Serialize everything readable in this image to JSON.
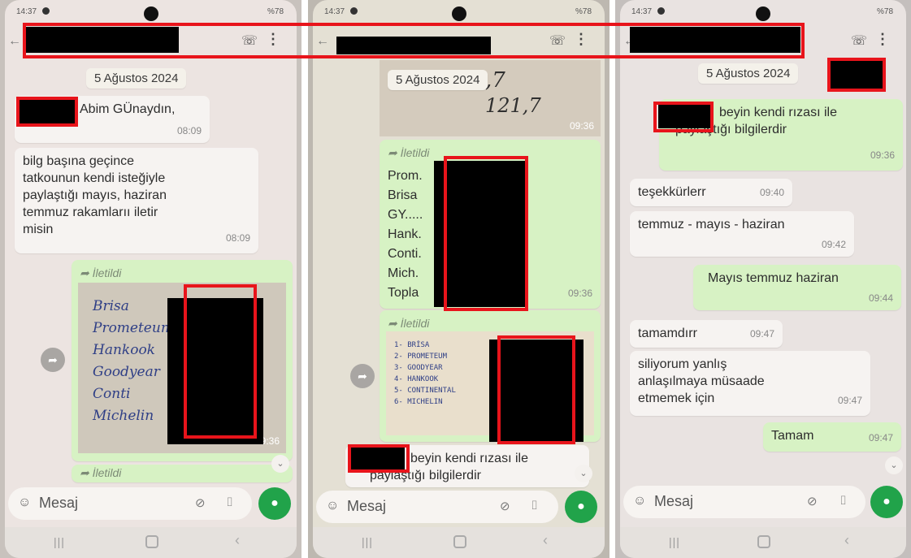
{
  "status": {
    "time": "14:37",
    "battery": "%78"
  },
  "labels": {
    "date": "5 Ağustos 2024",
    "forwarded": "İletildi",
    "input_placeholder": "Mesaj"
  },
  "icons": {
    "back": "back-arrow-icon",
    "call": "add-call-icon",
    "more": "more-vert-icon",
    "emoji": "emoji-icon",
    "attach": "paperclip-icon",
    "camera": "camera-icon",
    "mic": "mic-icon",
    "forward": "forward-icon"
  },
  "phone1": {
    "msg1": {
      "text": "Abim GÜnaydın,",
      "time": "08:09"
    },
    "msg2": {
      "lines": [
        "bilg başına geçince",
        "tatkounun kendi isteğiyle",
        "paylaştığı mayıs, haziran",
        "temmuz rakamlarıı iletir",
        "misin"
      ],
      "time": "08:09"
    },
    "photo_time": "09:36",
    "photo_words": [
      "Brisa",
      "Prometeum",
      "Hankook",
      "Goodyear",
      "Conti",
      "Michelin"
    ]
  },
  "phone2": {
    "photo_top_time": "09:36",
    "list": [
      "Prom.",
      "Brisa",
      "GY.....",
      "Hank.",
      "Conti.",
      "Mich.",
      "Topla"
    ],
    "list_time": "09:36",
    "photo2_words": [
      "1- BRİSA",
      "2- PROMETEUM",
      "3- GOODYEAR",
      "4- HANKOOK",
      "5- CONTINENTAL",
      "6- MICHELIN"
    ],
    "last_lines": [
      "beyin kendi rızası ile",
      "paylaştığı bilgilerdir"
    ]
  },
  "phone3": {
    "msg_top": {
      "lines": [
        "beyin kendi rızası ile",
        "paylaştığı bilgilerdir"
      ],
      "time": "09:36"
    },
    "msgs": [
      {
        "text": "teşekkürlerr",
        "time": "09:40"
      },
      {
        "text": "temmuz - mayıs - haziran",
        "time": "09:42"
      },
      {
        "text": "Mayıs temmuz haziran",
        "time": "09:44"
      },
      {
        "text": "tamamdırr",
        "time": "09:47"
      },
      {
        "lines": [
          "siliyorum yanlış",
          "anlaşılmaya müsaade",
          "etmemek için"
        ],
        "time": "09:47"
      },
      {
        "text": "Tamam",
        "time": "09:47"
      }
    ]
  }
}
